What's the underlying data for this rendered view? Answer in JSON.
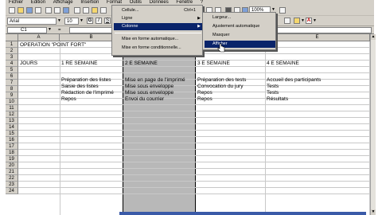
{
  "menubar": [
    "Fichier",
    "Edition",
    "Affichage",
    "Insertion",
    "Format",
    "Outils",
    "Données",
    "Fenêtre",
    "?"
  ],
  "toolbar": {
    "zoom": "100%",
    "font_name": "Arial",
    "font_size": "10"
  },
  "formula_bar": {
    "name_box": "C1",
    "fx": "="
  },
  "columns": [
    "A",
    "B",
    "C",
    "D",
    "E"
  ],
  "rows": [
    "1",
    "2",
    "3",
    "4",
    "5",
    "6",
    "7",
    "8",
    "9",
    "10",
    "11",
    "12",
    "13",
    "14",
    "15",
    "16",
    "17",
    "18",
    "19",
    "20",
    "21",
    "22",
    "23",
    "24"
  ],
  "cells": {
    "a1": "OPERATION \"POINT FORT\"",
    "a3": "JOURS",
    "b3": "1 RE SEMAINE",
    "c3": "2 E SEMAINE",
    "d3": "3 E SEMAINE",
    "e3": "4 E SEMAINE",
    "b5": "Préparation des listes",
    "b6": "Saisie des listes",
    "b7": "Rédaction de l'imprimé",
    "b8": "Repos",
    "c5": "Mise en page de l'imprimé",
    "c6": "Mise sous enveloppe",
    "c7": "Mise sous enveloppe",
    "c8": "Envoi du courrier",
    "d5": "Préparation des tests",
    "d6": "Convocation du jury",
    "d7": "Repos",
    "d8": "Repos",
    "e5": "Accueil des participants",
    "e6": "Tests",
    "e7": "Tests",
    "e8": "Résultats"
  },
  "format_menu": {
    "items": [
      {
        "label": "Cellule...",
        "shortcut": "Ctrl+1"
      },
      {
        "label": "Ligne",
        "has_submenu": true
      },
      {
        "label": "Colonne",
        "has_submenu": true
      },
      {
        "label": "Mise en forme automatique..."
      },
      {
        "label": "Mise en forme conditionnelle..."
      }
    ]
  },
  "column_submenu": {
    "items": [
      {
        "label": "Largeur..."
      },
      {
        "label": "Ajustement automatique"
      },
      {
        "label": "Masquer"
      },
      {
        "label": "Afficher"
      }
    ]
  },
  "colors": {
    "chrome": "#d4d0c8",
    "highlight": "#0a246a",
    "selection": "#b8b8b8"
  }
}
